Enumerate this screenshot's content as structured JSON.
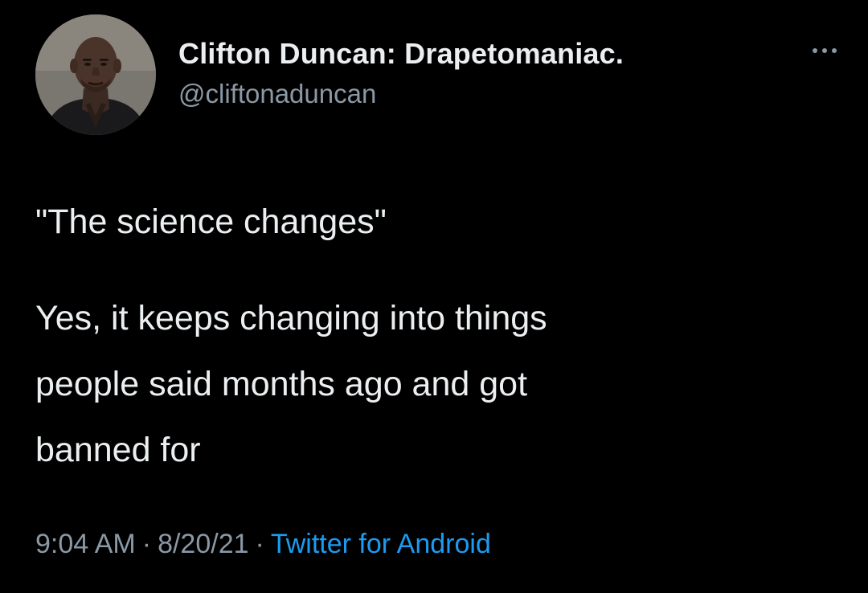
{
  "tweet": {
    "author": {
      "display_name": "Clifton Duncan: Drapetomaniac.",
      "handle": "@cliftonaduncan",
      "avatar_icon": "profile-photo"
    },
    "more_icon": "ellipsis-icon",
    "text": {
      "quote": "\"The science changes\"",
      "lines": [
        "Yes, it keeps changing into things",
        "people said months ago and got",
        "banned for"
      ]
    },
    "meta": {
      "time": "9:04 AM",
      "separator": "·",
      "date": "8/20/21",
      "source": "Twitter for Android"
    }
  },
  "colors": {
    "background": "#000000",
    "primary_text": "#eceff1",
    "secondary_text": "#8b98a5",
    "link": "#1d9bf0"
  }
}
